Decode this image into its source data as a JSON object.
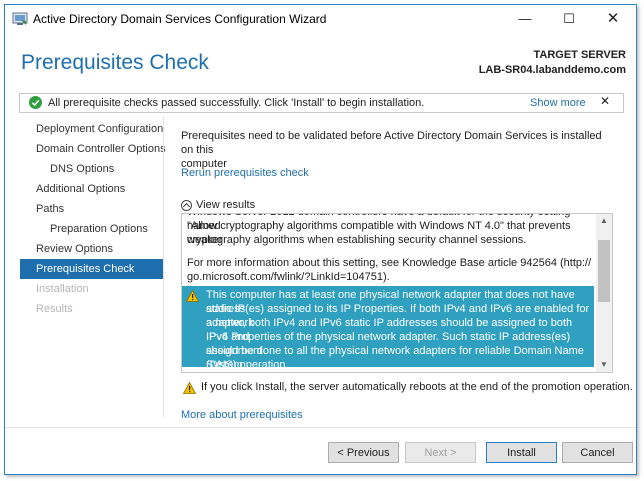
{
  "window": {
    "title": "Active Directory Domain Services Configuration Wizard",
    "minimize_glyph": "—",
    "maximize_glyph": "☐",
    "close_glyph": "✕",
    "accent": "#1f6fae"
  },
  "header": {
    "page_title": "Prerequisites Check",
    "target_label": "TARGET SERVER",
    "target_server": "LAB-SR04.labanddemo.com"
  },
  "banner": {
    "icon": "green-check-icon",
    "message": "All prerequisite checks passed successfully.  Click 'Install' to begin installation.",
    "show_more": "Show more",
    "close": "✕"
  },
  "nav": {
    "items": [
      {
        "label": "Deployment Configuration",
        "state": "normal"
      },
      {
        "label": "Domain Controller Options",
        "state": "normal"
      },
      {
        "label": "DNS Options",
        "state": "normal"
      },
      {
        "label": "Additional Options",
        "state": "normal"
      },
      {
        "label": "Paths",
        "state": "normal"
      },
      {
        "label": "Preparation Options",
        "state": "normal"
      },
      {
        "label": "Review Options",
        "state": "normal"
      },
      {
        "label": "Prerequisites Check",
        "state": "active"
      },
      {
        "label": "Installation",
        "state": "disabled"
      },
      {
        "label": "Results",
        "state": "disabled"
      }
    ]
  },
  "main": {
    "description_line1": "Prerequisites need to be validated before Active Directory Domain Services is installed on this",
    "description_line2": "computer",
    "rerun_link": "Rerun prerequisites check",
    "view_results": "View results",
    "results": {
      "cut_line": "Windows Server 2012 domain controllers have a default for the security setting named",
      "line1": "\"Allow cryptography algorithms compatible with Windows NT 4.0\" that prevents weaker",
      "line2": "cryptography algorithms when establishing security channel sessions.",
      "line3": "For more information about this setting, see Knowledge Base article 942564 (http://",
      "line4": "go.microsoft.com/fwlink/?LinkId=104751).",
      "warning_line1": "This computer has at least one physical network adapter that does not have static IP",
      "warning_line2": "address(es) assigned to its IP Properties. If both IPv4 and IPv6 are enabled for a network",
      "warning_line3": "adapter, both IPv4 and IPv6 static IP addresses should be assigned to both IPv4 and",
      "warning_line4": "IPv6 Properties of the physical network adapter. Such static IP address(es) assignment",
      "warning_line5": "should be done to all the physical network adapters for reliable Domain Name System",
      "warning_line6": "(DNS) operation.",
      "highlight_color": "#2fa0bf"
    },
    "reboot_warning": "If you click Install, the server automatically reboots at the end of the promotion operation.",
    "more_link": "More about prerequisites"
  },
  "footer": {
    "previous": "< Previous",
    "next": "Next >",
    "install": "Install",
    "cancel": "Cancel"
  }
}
